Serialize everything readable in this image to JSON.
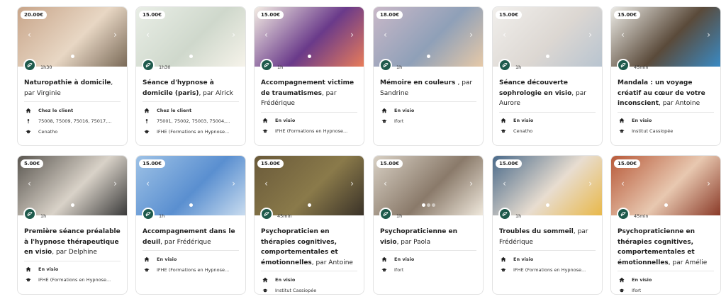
{
  "cards": [
    {
      "price": "20.00€",
      "duration": "1h30",
      "title_bold": "Naturopathie à domicile",
      "title_by": ", par Virginie",
      "location": "Chez le client",
      "zip": "75008, 75009, 75016, 75017,...",
      "school": "Cenatho",
      "thumb": "naturopathy-session",
      "colors": [
        "#c8a58a",
        "#e8d7c4",
        "#7a6a58"
      ],
      "dots": 1
    },
    {
      "price": "15.00€",
      "duration": "1h30",
      "title_bold": "Séance d'hypnose à domicile (paris)",
      "title_by": ", par Alrick",
      "location": "Chez le client",
      "zip": "75001, 75002, 75003, 75004,...",
      "school": "IFHE (Formations en Hypnose...",
      "thumb": "street-map",
      "colors": [
        "#e9eee6",
        "#cfd8cc",
        "#f6f3ea"
      ],
      "dots": 1
    },
    {
      "price": "15.00€",
      "duration": "1h",
      "title_bold": "Accompagnement victime de traumatismes",
      "title_by": ", par Frédérique",
      "location": "En visio",
      "zip": "",
      "school": "IFHE (Formations en Hypnose...",
      "thumb": "illustrated-girl",
      "colors": [
        "#f3ece3",
        "#6a3a8a",
        "#e87c5a"
      ],
      "dots": 1
    },
    {
      "price": "18.00€",
      "duration": "1h",
      "title_bold": "Mémoire en couleurs ",
      "title_by": ", par Sandrine",
      "location": "En visio",
      "zip": "",
      "school": "Ifort",
      "thumb": "colorful-cards",
      "colors": [
        "#c9b8c8",
        "#8fa0b8",
        "#e6c9a8"
      ],
      "dots": 1
    },
    {
      "price": "15.00€",
      "duration": "1h",
      "title_bold": "Séance découverte sophrologie en visio",
      "title_by": ", par Aurore",
      "location": "En visio",
      "zip": "",
      "school": "Cenatho",
      "thumb": "meditation",
      "colors": [
        "#f1efec",
        "#dcd7d2",
        "#b8c4d0"
      ],
      "dots": 1
    },
    {
      "price": "15.00€",
      "duration": "45min",
      "title_bold": "Mandala : un voyage créatif au cœur de votre inconscient",
      "title_by": ", par Antoine",
      "location": "En visio",
      "zip": "",
      "school": "Institut Cassiopée",
      "thumb": "colored-pencils",
      "colors": [
        "#ecebe6",
        "#5a4a3a",
        "#3a8ac4"
      ],
      "dots": 0
    },
    {
      "price": "5.00€",
      "duration": "1h",
      "title_bold": "Première séance préalable à l'hypnose thérapeutique en visio",
      "title_by": ", par Delphine",
      "location": "En visio",
      "zip": "",
      "school": "IFHE (Formations en Hypnose...",
      "thumb": "video-call",
      "colors": [
        "#5a5650",
        "#d9d2c8",
        "#3a3a3a"
      ],
      "dots": 1
    },
    {
      "price": "15.00€",
      "duration": "1h",
      "title_bold": "Accompagnement dans le deuil",
      "title_by": ", par Frédérique",
      "location": "En visio",
      "zip": "",
      "school": "IFHE (Formations en Hypnose...",
      "thumb": "sad-balloon",
      "colors": [
        "#9ec2e6",
        "#5a8fd0",
        "#c9dcef"
      ],
      "dots": 1
    },
    {
      "price": "15.00€",
      "duration": "45min",
      "title_bold": "Psychopraticien en thérapies cognitives, comportementales et émotionnelles",
      "title_by": ", par Antoine",
      "location": "En visio",
      "zip": "",
      "school": "Institut Cassiopée",
      "thumb": "man-portrait",
      "colors": [
        "#6a5a3a",
        "#8a7a4a",
        "#3a3228"
      ],
      "dots": 1
    },
    {
      "price": "15.00€",
      "duration": "1h",
      "title_bold": "Psychopraticienne en visio",
      "title_by": ", par Paola",
      "location": "En visio",
      "zip": "",
      "school": "Ifort",
      "thumb": "therapy-room",
      "colors": [
        "#d8d0c4",
        "#8a7a6a",
        "#efe8dc"
      ],
      "dots": 3
    },
    {
      "price": "15.00€",
      "duration": "1h",
      "title_bold": "Troubles du sommeil",
      "title_by": ", par Frédérique",
      "location": "En visio",
      "zip": "",
      "school": "IFHE (Formations en Hypnose...",
      "thumb": "sleepless-illustration",
      "colors": [
        "#4a6a8a",
        "#e8ddd0",
        "#e8b84a"
      ],
      "dots": 1
    },
    {
      "price": "15.00€",
      "duration": "45min",
      "title_bold": "Psychopraticienne en thérapies cognitives, comportementales et émotionnelles",
      "title_by": ", par Amélie",
      "location": "En visio",
      "zip": "",
      "school": "Ifort",
      "thumb": "woman-portrait",
      "colors": [
        "#b85a3a",
        "#e8c8b0",
        "#8a3a28"
      ],
      "dots": 1
    }
  ],
  "icons": {
    "location": "home-icon",
    "zip": "pin-icon",
    "school": "graduation-cap-icon",
    "badge": "trainee-badge-icon"
  },
  "accent": "#1e5a4c"
}
